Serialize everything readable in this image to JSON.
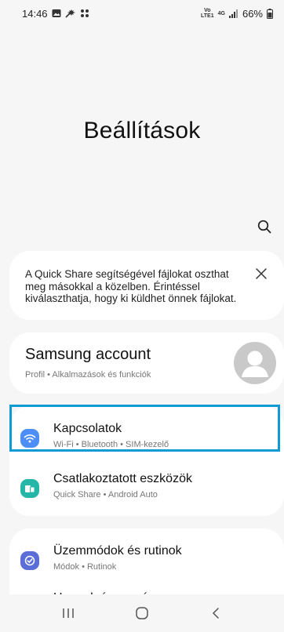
{
  "status_bar": {
    "time": "14:46",
    "network": "4G",
    "volte_top": "Vo",
    "volte_bottom": "LTE1",
    "battery": "66%"
  },
  "header": {
    "title": "Beállítások"
  },
  "icons": {
    "search": "search-icon",
    "close": "close-icon",
    "avatar": "person-icon",
    "connections": "wifi-icon",
    "connected_devices": "devices-icon",
    "modes": "check-circle-icon",
    "sounds": "speaker-icon"
  },
  "quick_share": {
    "message": "A Quick Share segítségével fájlokat oszthat meg másokkal a közelben. Érintéssel kiválaszthatja, hogy ki küldhet önnek fájlokat."
  },
  "account": {
    "title": "Samsung account",
    "subtitle": "Profil • Alkalmazások és funkciók"
  },
  "settings": [
    {
      "title": "Kapcsolatok",
      "subtitle": "Wi-Fi • Bluetooth • SIM-kezelő",
      "color": "#4c8df6"
    },
    {
      "title": "Csatlakoztatott eszközök",
      "subtitle": "Quick Share • Android Auto",
      "color": "#24b7a8"
    },
    {
      "title": "Üzemmódok és rutinok",
      "subtitle": "Módok • Rutinok",
      "color": "#5b6ed8"
    },
    {
      "title": "Hangok és rezgés",
      "subtitle": "",
      "color": "#8a5cf0"
    }
  ],
  "colors": {
    "highlight": "#0f9ad6",
    "background": "#f6f6f6",
    "card": "#ffffff"
  }
}
